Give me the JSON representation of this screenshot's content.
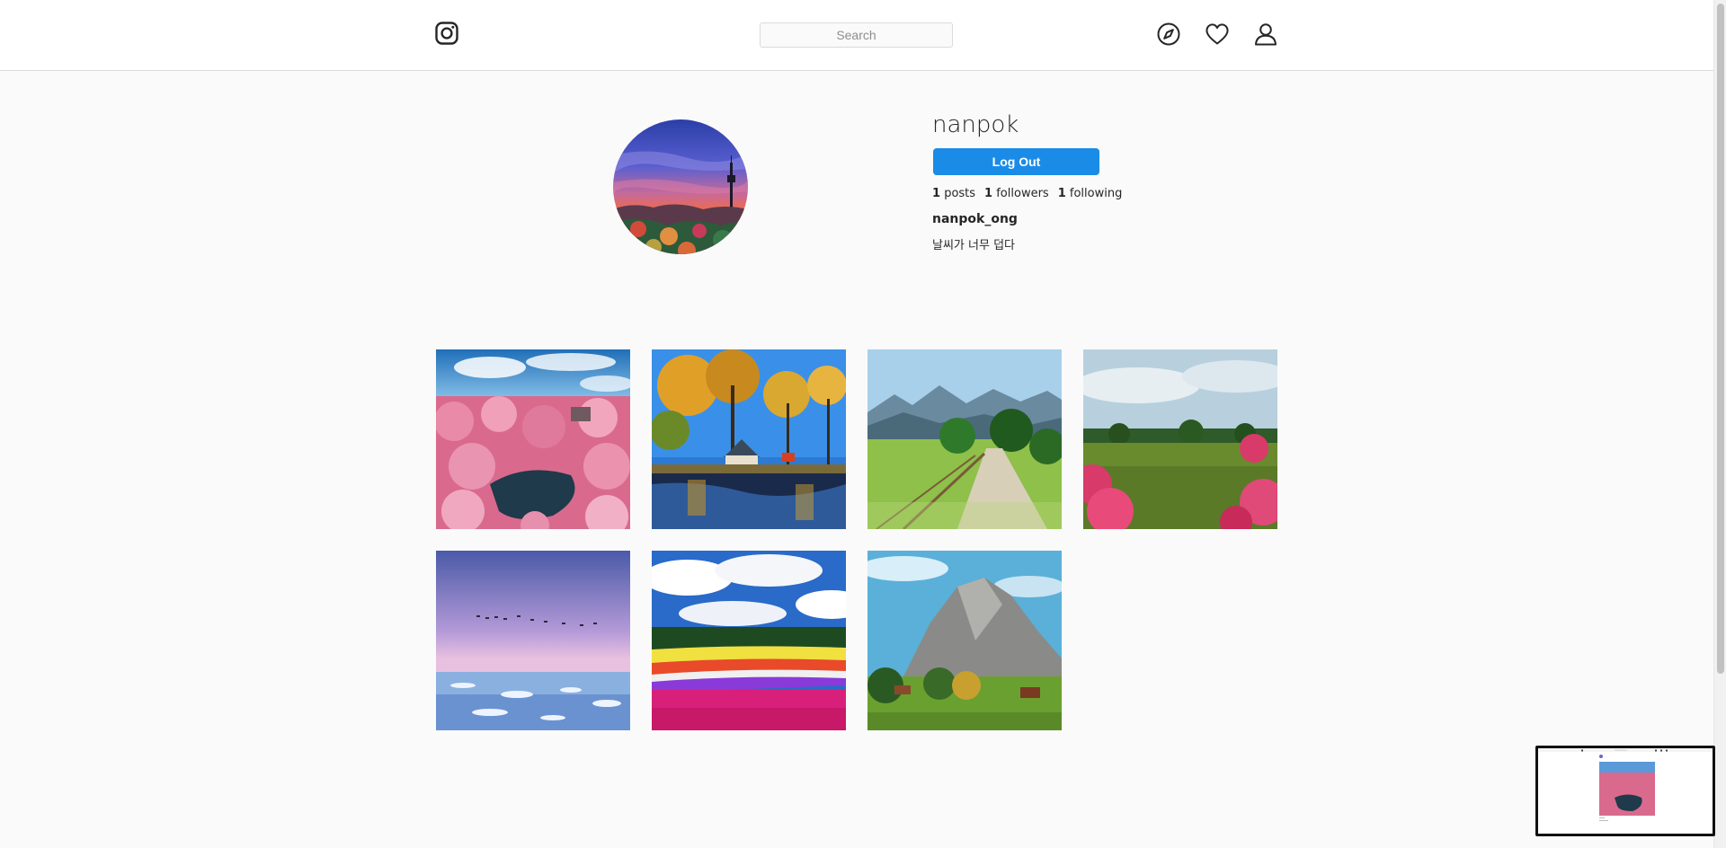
{
  "header": {
    "logo_icon": "instagram-icon",
    "search": {
      "placeholder": "Search",
      "value": ""
    },
    "nav": [
      {
        "id": "explore",
        "icon": "compass-icon"
      },
      {
        "id": "activity",
        "icon": "heart-icon"
      },
      {
        "id": "profile",
        "icon": "user-icon"
      }
    ]
  },
  "profile": {
    "username": "nanpok",
    "logout_label": "Log Out",
    "stats": {
      "posts_count": "1",
      "posts_label": "posts",
      "followers_count": "1",
      "followers_label": "followers",
      "following_count": "1",
      "following_label": "following"
    },
    "full_name": "nanpok_ong",
    "bio": "날씨가 너무 덥다"
  },
  "posts": [
    {
      "scene": "pink-forest-lake"
    },
    {
      "scene": "autumn-trees-pond"
    },
    {
      "scene": "mountain-path-fence"
    },
    {
      "scene": "green-field-flowers"
    },
    {
      "scene": "lavender-sky-sea"
    },
    {
      "scene": "flower-field-clouds"
    },
    {
      "scene": "alpine-peak-village"
    }
  ],
  "colors": {
    "accent": "#1a8ce8",
    "background": "#fafafa",
    "header_bg": "#ffffff",
    "border": "#dbdbdb"
  }
}
